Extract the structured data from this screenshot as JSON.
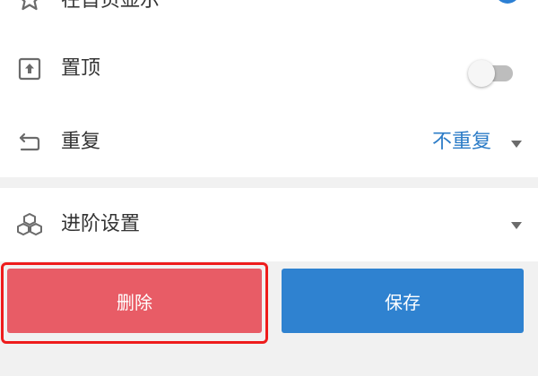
{
  "settings": {
    "show_on_home": {
      "label": "在首页显示",
      "icon": "star-icon",
      "enabled": true
    },
    "pin": {
      "label": "置顶",
      "icon": "pin-top-icon",
      "enabled": false
    },
    "repeat": {
      "label": "重复",
      "icon": "repeat-icon",
      "value": "不重复"
    },
    "advanced": {
      "label": "进阶设置",
      "icon": "cubes-icon"
    }
  },
  "actions": {
    "delete_label": "删除",
    "save_label": "保存"
  },
  "colors": {
    "accent": "#2f82d0",
    "danger": "#e85c66",
    "highlight": "#ee1c1c"
  }
}
